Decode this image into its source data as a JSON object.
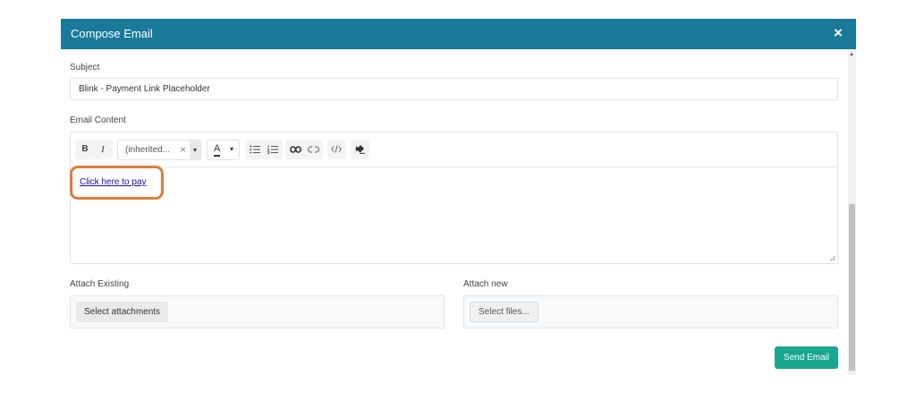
{
  "dialog": {
    "title": "Compose Email",
    "close_label": "×"
  },
  "subject": {
    "label": "Subject",
    "value": "Blink - Payment Link Placeholder"
  },
  "content": {
    "label": "Email Content",
    "toolbar": {
      "bold": "B",
      "italic": "I",
      "font_family": "(inherited...",
      "font_clear": "×",
      "dropdown_arrow": "▾",
      "text_color_glyph": "A",
      "icons": [
        "bold-icon",
        "italic-icon",
        "text-color-icon",
        "bullet-list-icon",
        "numbered-list-icon",
        "link-icon",
        "unlink-icon",
        "code-view-icon",
        "clear-format-icon"
      ]
    },
    "link_text": "Click here to pay",
    "highlight_color": "#e07b3c"
  },
  "attach_existing": {
    "label": "Attach Existing",
    "button": "Select attachments"
  },
  "attach_new": {
    "label": "Attach new",
    "button": "Select files..."
  },
  "send_button": "Send Email",
  "colors": {
    "header": "#1a7a99",
    "send": "#1aa58e",
    "link": "#1a0dab"
  }
}
